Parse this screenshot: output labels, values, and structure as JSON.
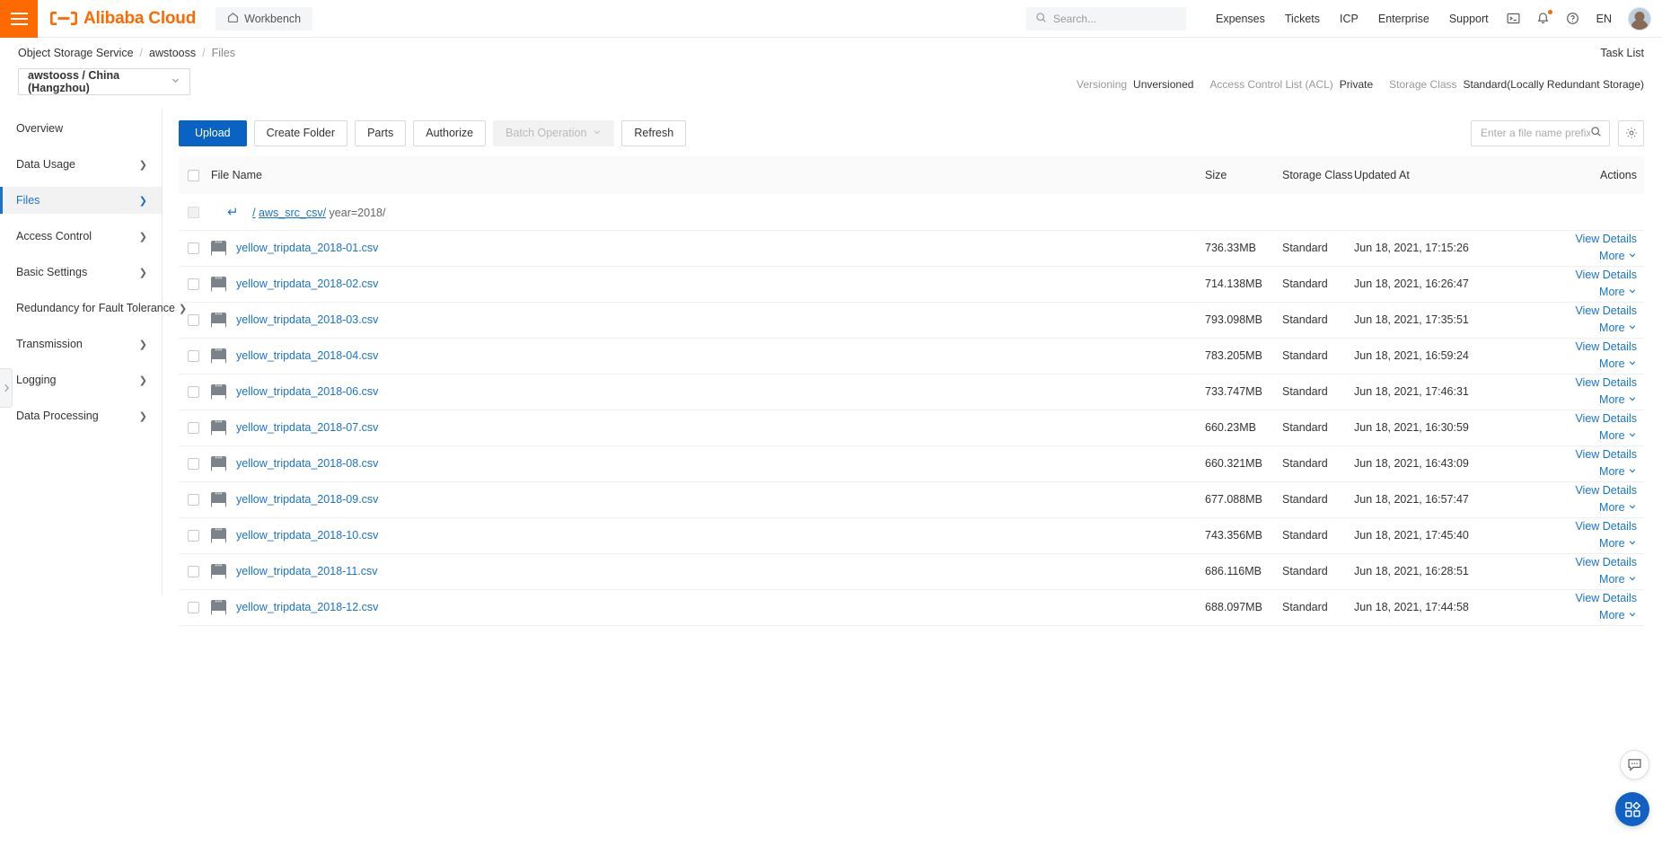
{
  "header": {
    "menu_icon": "hamburger-icon",
    "brand": "Alibaba Cloud",
    "workbench": "Workbench",
    "home_icon": "home-icon",
    "search_placeholder": "Search...",
    "search_icon": "search-icon",
    "nav": [
      {
        "label": "Expenses"
      },
      {
        "label": "Tickets"
      },
      {
        "label": "ICP"
      },
      {
        "label": "Enterprise"
      },
      {
        "label": "Support"
      }
    ],
    "console_icon": "terminal-icon",
    "bell_icon": "bell-icon",
    "help_icon": "question-circle-icon",
    "language": "EN",
    "avatar": "user-avatar"
  },
  "breadcrumb": {
    "items": [
      "Object Storage Service",
      "awstooss",
      "Files"
    ],
    "separator": "/",
    "task_list": "Task List"
  },
  "bucket": {
    "selected": "awstooss / China (Hangzhou)",
    "chevron": "chevron-down-icon"
  },
  "meta": {
    "versioning_label": "Versioning",
    "versioning_value": "Unversioned",
    "acl_label": "Access Control List (ACL)",
    "acl_value": "Private",
    "storage_class_label": "Storage Class",
    "storage_class_value": "Standard(Locally Redundant Storage)"
  },
  "sidebar": {
    "items": [
      {
        "label": "Overview",
        "chevron": false,
        "active": false
      },
      {
        "label": "Data Usage",
        "chevron": true,
        "active": false
      },
      {
        "label": "Files",
        "chevron": true,
        "active": true
      },
      {
        "label": "Access Control",
        "chevron": true,
        "active": false
      },
      {
        "label": "Basic Settings",
        "chevron": true,
        "active": false
      },
      {
        "label": "Redundancy for Fault Tolerance",
        "chevron": true,
        "active": false
      },
      {
        "label": "Transmission",
        "chevron": true,
        "active": false
      },
      {
        "label": "Logging",
        "chevron": true,
        "active": false
      },
      {
        "label": "Data Processing",
        "chevron": true,
        "active": false
      }
    ],
    "collapse_icon": "chevron-right-icon"
  },
  "toolbar": {
    "upload": "Upload",
    "create_folder": "Create Folder",
    "parts": "Parts",
    "authorize": "Authorize",
    "batch_operation": "Batch Operation",
    "refresh": "Refresh",
    "search_placeholder": "Enter a file name prefix",
    "search_icon": "search-icon",
    "settings_icon": "gear-icon"
  },
  "table": {
    "columns": {
      "file_name": "File Name",
      "size": "Size",
      "storage_class": "Storage Class",
      "updated_at": "Updated At",
      "actions": "Actions"
    },
    "path_row": {
      "back_icon": "back-arrow-icon",
      "root": "/",
      "folder": "aws_src_csv/",
      "current": "year=2018/"
    },
    "action_view": "View Details",
    "action_more": "More",
    "more_chevron": "chevron-down-icon",
    "file_icon": "csv-file-icon",
    "rows": [
      {
        "name": "yellow_tripdata_2018-01.csv",
        "size": "736.33MB",
        "storage_class": "Standard",
        "updated_at": "Jun 18, 2021, 17:15:26"
      },
      {
        "name": "yellow_tripdata_2018-02.csv",
        "size": "714.138MB",
        "storage_class": "Standard",
        "updated_at": "Jun 18, 2021, 16:26:47"
      },
      {
        "name": "yellow_tripdata_2018-03.csv",
        "size": "793.098MB",
        "storage_class": "Standard",
        "updated_at": "Jun 18, 2021, 17:35:51"
      },
      {
        "name": "yellow_tripdata_2018-04.csv",
        "size": "783.205MB",
        "storage_class": "Standard",
        "updated_at": "Jun 18, 2021, 16:59:24"
      },
      {
        "name": "yellow_tripdata_2018-06.csv",
        "size": "733.747MB",
        "storage_class": "Standard",
        "updated_at": "Jun 18, 2021, 17:46:31"
      },
      {
        "name": "yellow_tripdata_2018-07.csv",
        "size": "660.23MB",
        "storage_class": "Standard",
        "updated_at": "Jun 18, 2021, 16:30:59"
      },
      {
        "name": "yellow_tripdata_2018-08.csv",
        "size": "660.321MB",
        "storage_class": "Standard",
        "updated_at": "Jun 18, 2021, 16:43:09"
      },
      {
        "name": "yellow_tripdata_2018-09.csv",
        "size": "677.088MB",
        "storage_class": "Standard",
        "updated_at": "Jun 18, 2021, 16:57:47"
      },
      {
        "name": "yellow_tripdata_2018-10.csv",
        "size": "743.356MB",
        "storage_class": "Standard",
        "updated_at": "Jun 18, 2021, 17:45:40"
      },
      {
        "name": "yellow_tripdata_2018-11.csv",
        "size": "686.116MB",
        "storage_class": "Standard",
        "updated_at": "Jun 18, 2021, 16:28:51"
      },
      {
        "name": "yellow_tripdata_2018-12.csv",
        "size": "688.097MB",
        "storage_class": "Standard",
        "updated_at": "Jun 18, 2021, 17:44:58"
      }
    ]
  },
  "floating": {
    "chat_icon": "chat-bubble-icon",
    "apps_icon": "apps-grid-icon"
  },
  "colors": {
    "brand_orange": "#ff6a00",
    "link_blue": "#1a73c9",
    "primary_blue": "#0a63c2"
  }
}
